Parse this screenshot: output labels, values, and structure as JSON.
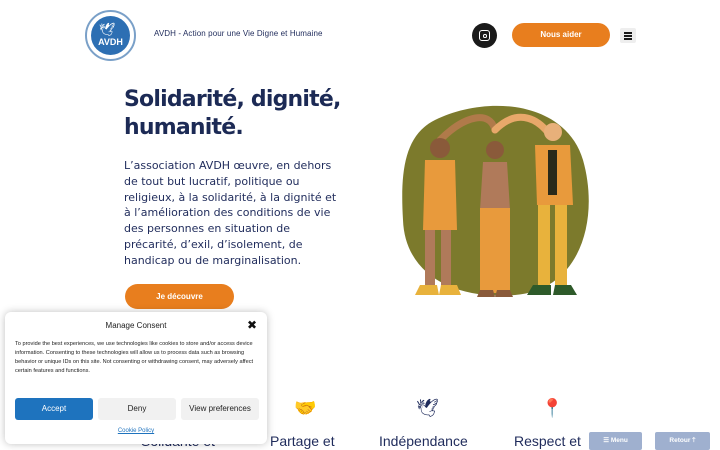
{
  "header": {
    "logo_text": "AVDH",
    "site_title": "AVDH - Action pour une Vie Digne et Humaine",
    "social_icon": "instagram-icon",
    "help_button": "Nous aider",
    "menu_icon": "hamburger-icon"
  },
  "hero": {
    "title_line1": "Solidarité, dignité,",
    "title_line2": "humanité.",
    "text": "L’association AVDH œuvre, en dehors de tout but lucratif, politique ou religieux, à la solidarité, à la dignité et à l’amélioration des conditions de vie des personnes en situation de précarité, d’exil, d’isolement, de handicap ou de marginalisation.",
    "button": "Je découvre"
  },
  "values": [
    {
      "label": "Solidarité et",
      "icon": "handshake-icon",
      "glyph": ""
    },
    {
      "label": "Partage et",
      "icon": "handshake-icon",
      "glyph": "🤝"
    },
    {
      "label": "Indépendance",
      "icon": "dove-icon",
      "glyph": "🕊"
    },
    {
      "label": "Respect et",
      "icon": "pin-icon",
      "glyph": "📍"
    }
  ],
  "consent": {
    "title": "Manage Consent",
    "text": "To provide the best experiences, we use technologies like cookies to store and/or access device information. Consenting to these technologies will allow us to process data such as browsing behavior or unique IDs on this site. Not consenting or withdrawing consent, may adversely affect certain features and functions.",
    "accept": "Accept",
    "deny": "Deny",
    "preferences": "View preferences",
    "policy_link": "Cookie Policy",
    "close_glyph": "✖"
  },
  "floating": {
    "menu": "☰ Menu",
    "top": "Retour 🡑"
  },
  "colors": {
    "accent": "#e87e1e",
    "navy": "#1c2a55",
    "blue": "#1e73be",
    "illustration_bg": "#7c7a2c"
  }
}
